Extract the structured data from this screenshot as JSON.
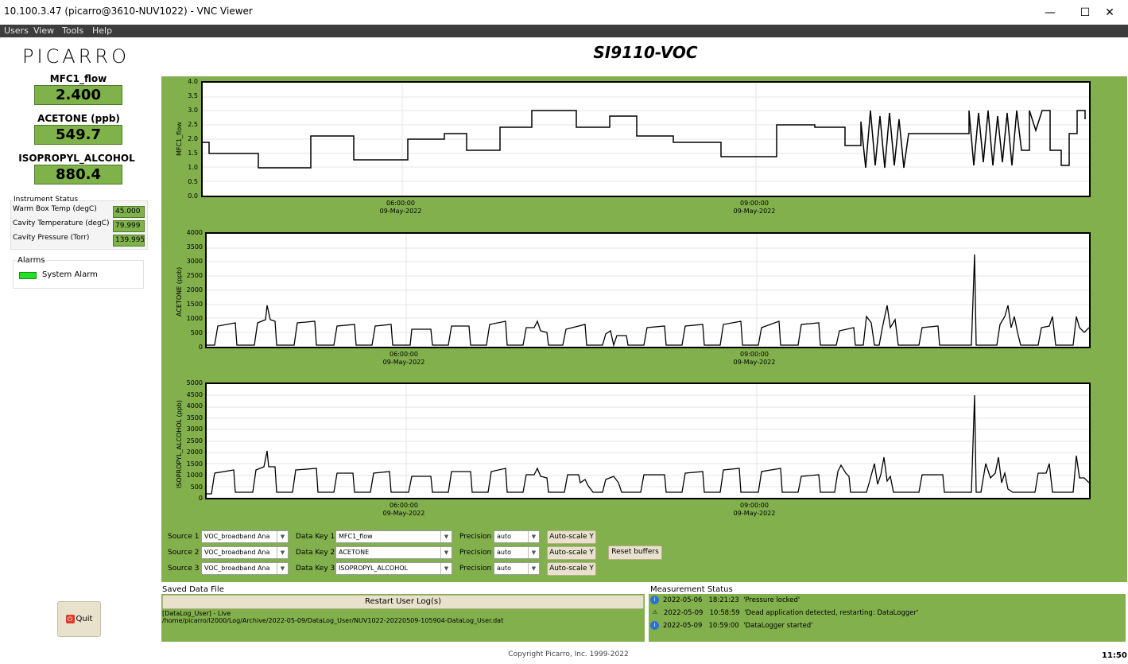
{
  "window": {
    "title": "10.100.3.47 (picarro@3610-NUV1022) - VNC Viewer",
    "minimize": "—",
    "maximize": "☐",
    "close": "✕"
  },
  "menu": [
    "Users",
    "View",
    "Tools",
    "Help"
  ],
  "logo": "PICARRO",
  "app_title": "SI9110-VOC",
  "measurements": [
    {
      "label": "MFC1_flow",
      "value": "2.400"
    },
    {
      "label": "ACETONE (ppb)",
      "value": "549.7"
    },
    {
      "label": "ISOPROPYL_ALCOHOL",
      "value": "880.4"
    }
  ],
  "instrument_status": {
    "title": "Instrument Status",
    "rows": [
      {
        "label": "Warm Box Temp (degC)",
        "value": "45.000"
      },
      {
        "label": "Cavity Temperature (degC)",
        "value": "79.999"
      },
      {
        "label": "Cavity Pressure (Torr)",
        "value": "139.995"
      }
    ]
  },
  "alarms": {
    "title": "Alarms",
    "items": [
      {
        "label": "System Alarm",
        "color": "#26e026"
      }
    ]
  },
  "quit_label": "Quit",
  "plots": [
    {
      "ylabel": "MFC1_flow",
      "yticks": [
        "4.0",
        "3.5",
        "3.0",
        "2.5",
        "2.0",
        "1.5",
        "1.0",
        "0.5",
        "0.0"
      ],
      "xticks": [
        {
          "time": "06:00:00",
          "date": "09-May-2022"
        },
        {
          "time": "09:00:00",
          "date": "09-May-2022"
        }
      ]
    },
    {
      "ylabel": "ACETONE (ppb)",
      "yticks": [
        "4000",
        "3500",
        "3000",
        "2500",
        "2000",
        "1500",
        "1000",
        "500",
        "0"
      ],
      "xticks": [
        {
          "time": "06:00:00",
          "date": "09-May-2022"
        },
        {
          "time": "09:00:00",
          "date": "09-May-2022"
        }
      ]
    },
    {
      "ylabel": "ISOPROPYL_ALCOHOL (ppb)",
      "yticks": [
        "5000",
        "4500",
        "4000",
        "3500",
        "3000",
        "2500",
        "2000",
        "1500",
        "1000",
        "500",
        "0"
      ],
      "xticks": [
        {
          "time": "06:00:00",
          "date": "09-May-2022"
        },
        {
          "time": "09:00:00",
          "date": "09-May-2022"
        }
      ]
    }
  ],
  "controls": {
    "rows": [
      {
        "source_label": "Source 1",
        "source": "VOC_broadband Ana",
        "key_label": "Data Key 1",
        "key": "MFC1_flow",
        "prec_label": "Precision",
        "prec": "auto",
        "autoscale": "Auto-scale Y"
      },
      {
        "source_label": "Source 2",
        "source": "VOC_broadband Ana",
        "key_label": "Data Key 2",
        "key": "ACETONE",
        "prec_label": "Precision",
        "prec": "auto",
        "autoscale": "Auto-scale Y"
      },
      {
        "source_label": "Source 3",
        "source": "VOC_broadband Ana",
        "key_label": "Data Key 3",
        "key": "ISOPROPYL_ALCOHOL",
        "prec_label": "Precision",
        "prec": "auto",
        "autoscale": "Auto-scale Y"
      }
    ],
    "reset_buffers": "Reset buffers"
  },
  "saved_data": {
    "title": "Saved Data File",
    "restart": "Restart User Log(s)",
    "line1": "[DataLog_User] - Live",
    "line2": "/home/picarro/I2000/Log/Archive/2022-05-09/DataLog_User/NUV1022-20220509-105904-DataLog_User.dat"
  },
  "measurement_status": {
    "title": "Measurement Status",
    "rows": [
      {
        "icon": "info-icon",
        "date": "2022-05-06",
        "time": "18:21:23",
        "msg": "'Pressure locked'"
      },
      {
        "icon": "warning-icon",
        "date": "2022-05-09",
        "time": "10:58:59",
        "msg": "'Dead application detected, restarting: DataLogger'"
      },
      {
        "icon": "info-icon",
        "date": "2022-05-09",
        "time": "10:59:00",
        "msg": "'DataLogger started'"
      }
    ]
  },
  "copyright": "Copyright Picarro, Inc. 1999-2022",
  "clock": "11:50"
}
